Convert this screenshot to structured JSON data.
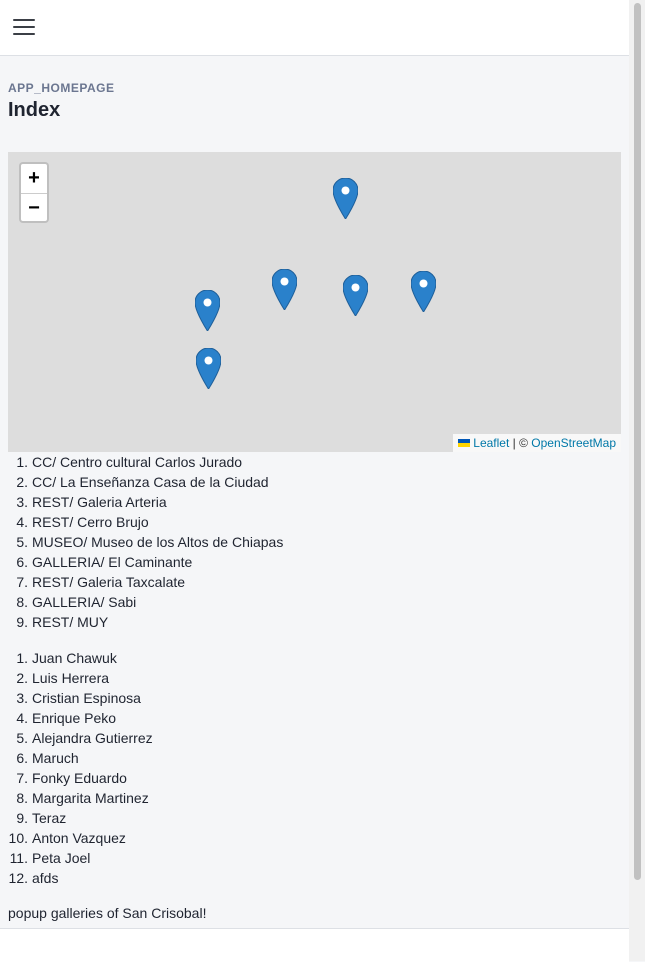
{
  "header": {
    "menu_icon": "hamburger-menu-icon"
  },
  "page": {
    "eyebrow": "APP_HOMEPAGE",
    "title": "Index"
  },
  "map": {
    "zoom_in": "+",
    "zoom_out": "−",
    "marker_color": "#2a81cb",
    "marker_count": 6,
    "attribution": {
      "leaflet": "Leaflet",
      "separator": " | © ",
      "osm": "OpenStreetMap"
    }
  },
  "places": [
    "CC/ Centro cultural Carlos Jurado",
    "CC/ La Enseñanza Casa de la Ciudad",
    "REST/ Galeria Arteria",
    "REST/ Cerro Brujo",
    "MUSEO/ Museo de los Altos de Chiapas",
    "GALLERIA/ El Caminante",
    "REST/ Galeria Taxcalate",
    "GALLERIA/ Sabi",
    "REST/ MUY"
  ],
  "artists": [
    "Juan Chawuk",
    "Luis Herrera",
    "Cristian Espinosa",
    "Enrique Peko",
    "Alejandra Gutierrez",
    "Maruch",
    "Fonky Eduardo",
    "Margarita Martinez",
    "Teraz",
    "Anton Vazquez",
    "Peta Joel",
    "afds"
  ],
  "footer": {
    "text": "popup galleries of San Crisobal!"
  }
}
